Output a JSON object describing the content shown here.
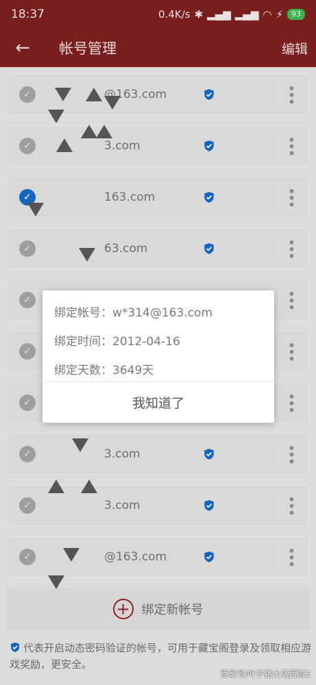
{
  "status_bar": {
    "time": "18:37",
    "network_speed": "0.4K/s",
    "battery_level": "93"
  },
  "app_bar": {
    "title": "帐号管理",
    "edit_label": "编辑",
    "back_icon": "arrow-left-icon"
  },
  "accounts": [
    {
      "email": "@163.com",
      "checked": false
    },
    {
      "email": "3.com",
      "checked": false
    },
    {
      "email": "163.com",
      "checked": true
    },
    {
      "email": "63.com",
      "checked": false
    },
    {
      "email": "",
      "checked": false
    },
    {
      "email": "",
      "checked": false
    },
    {
      "email": "",
      "checked": false
    },
    {
      "email": "3.com",
      "checked": false
    },
    {
      "email": "3.com",
      "checked": false
    },
    {
      "email": "@163.com",
      "checked": false
    }
  ],
  "add_account_label": "绑定新帐号",
  "footer_note": "代表开启动态密码验证的帐号，可用于藏宝阁登录及领取相应游戏奖励，更安全。",
  "watermark": "百家号/叶子猪大话西游2",
  "dialog": {
    "account_line": "绑定帐号：w*314@163.com",
    "time_line": "绑定时间：2012-04-16",
    "days_line": "绑定天数：3649天",
    "ok_label": "我知道了"
  },
  "colors": {
    "header": "#7a1e1e",
    "shield": "#1565c0",
    "plus": "#8b2020"
  }
}
